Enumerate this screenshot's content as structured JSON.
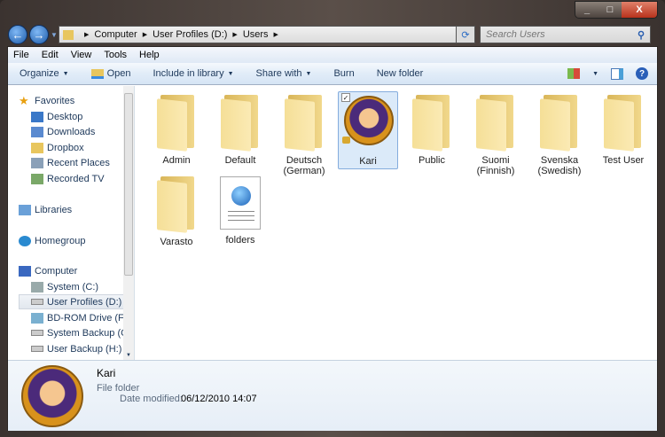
{
  "address": {
    "crumbs": [
      "Computer",
      "User Profiles (D:)",
      "Users"
    ]
  },
  "search": {
    "placeholder": "Search Users"
  },
  "menu": [
    "File",
    "Edit",
    "View",
    "Tools",
    "Help"
  ],
  "toolbar": {
    "organize": "Organize",
    "open": "Open",
    "include": "Include in library",
    "share": "Share with",
    "burn": "Burn",
    "new_folder": "New folder"
  },
  "nav": {
    "favorites": "Favorites",
    "fav_items": [
      "Desktop",
      "Downloads",
      "Dropbox",
      "Recent Places",
      "Recorded TV"
    ],
    "libraries": "Libraries",
    "homegroup": "Homegroup",
    "computer": "Computer",
    "drives": [
      "System (C:)",
      "User Profiles (D:)",
      "BD-ROM Drive (F:) C",
      "System Backup (G:)",
      "User Backup (H:)"
    ]
  },
  "items": [
    {
      "name": "Admin",
      "type": "folder"
    },
    {
      "name": "Default",
      "type": "folder"
    },
    {
      "name": "Deutsch (German)",
      "type": "folder"
    },
    {
      "name": "Kari",
      "type": "user",
      "selected": true
    },
    {
      "name": "Public",
      "type": "folder"
    },
    {
      "name": "Suomi (Finnish)",
      "type": "folder"
    },
    {
      "name": "Svenska (Swedish)",
      "type": "folder"
    },
    {
      "name": "Test User",
      "type": "folder"
    },
    {
      "name": "Varasto",
      "type": "folder"
    },
    {
      "name": "folders",
      "type": "html"
    }
  ],
  "details": {
    "name": "Kari",
    "type": "File folder",
    "modified_label": "Date modified:",
    "modified_value": "06/12/2010 14:07"
  }
}
